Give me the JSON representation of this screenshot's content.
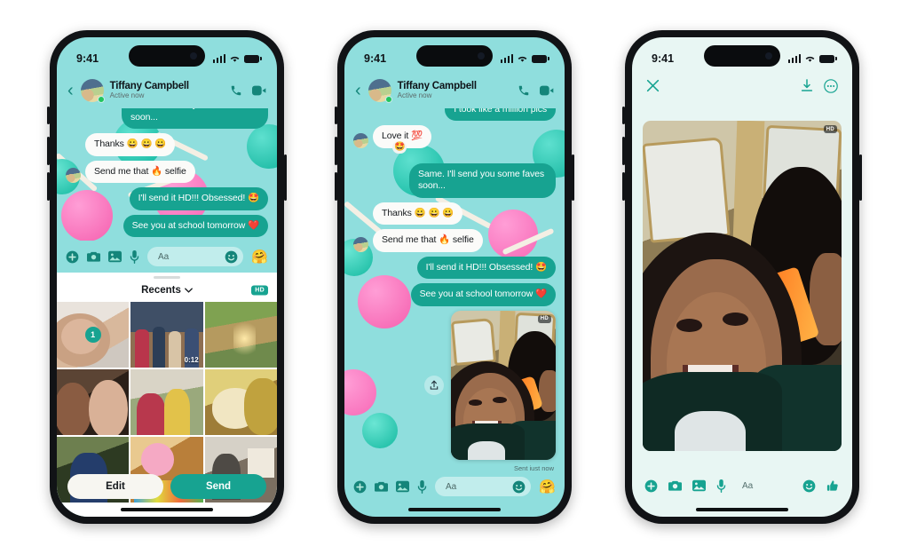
{
  "meta": {
    "accent": "#17a391",
    "chat_bg": "#8fdedd",
    "viewer_bg": "#e8f6f3",
    "bubble_out": "#17a391",
    "bubble_in": "#fbfbf9"
  },
  "status_bar": {
    "time": "9:41",
    "signal_icon": "cellular-signal-icon",
    "wifi_icon": "wifi-icon",
    "battery_icon": "battery-icon"
  },
  "chat_header": {
    "back_icon": "back-chevron-icon",
    "avatar": "contact-avatar",
    "name": "Tiffany Campbell",
    "status": "Active now",
    "call_icon": "phone-call-icon",
    "video_icon": "video-call-icon"
  },
  "phone1": {
    "messages": [
      {
        "id": "m1",
        "dir": "out",
        "text": "Same. I'll send you some faves soon..."
      },
      {
        "id": "m2",
        "dir": "in",
        "text": "Thanks 😀 😀 😀"
      },
      {
        "id": "m3",
        "dir": "in",
        "text": "Send me that 🔥 selfie"
      },
      {
        "id": "m4",
        "dir": "out",
        "text": "I'll send it HD!!! Obsessed! 🤩"
      },
      {
        "id": "m5",
        "dir": "out",
        "text": "See you at school tomorrow ❤️"
      }
    ],
    "input_bar": {
      "plus_icon": "add-attachment-icon",
      "camera_icon": "camera-icon",
      "gallery_icon": "photo-gallery-icon",
      "mic_icon": "microphone-icon",
      "placeholder": "Aa",
      "sticker_icon": "sticker-smiley-icon",
      "like_emoji": "🤗"
    },
    "tray": {
      "title": "Recents",
      "chevron_icon": "chevron-down-icon",
      "hd_badge": "HD",
      "selected_count": "1",
      "video_duration": "0:12",
      "edit_label": "Edit",
      "send_label": "Send"
    }
  },
  "phone2": {
    "messages": [
      {
        "id": "p2m0",
        "dir": "out",
        "text": "I took like a million pics"
      },
      {
        "id": "p2m1",
        "dir": "in",
        "text": "Love it 💯",
        "reaction": "🤩"
      },
      {
        "id": "p2m2",
        "dir": "out",
        "text": "Same. I'll send you some faves soon..."
      },
      {
        "id": "p2m3",
        "dir": "in",
        "text": "Thanks 😀 😀 😀"
      },
      {
        "id": "p2m4",
        "dir": "in",
        "text": "Send me that 🔥 selfie"
      },
      {
        "id": "p2m5",
        "dir": "out",
        "text": "I'll send it HD!!! Obsessed! 🤩"
      },
      {
        "id": "p2m6",
        "dir": "out",
        "text": "See you at school tomorrow ❤️"
      }
    ],
    "photo_message": {
      "share_icon": "share-upload-icon",
      "hd_badge": "HD",
      "sent_label": "Sent just now"
    },
    "input_bar": {
      "plus_icon": "add-attachment-icon",
      "camera_icon": "camera-icon",
      "gallery_icon": "photo-gallery-icon",
      "mic_icon": "microphone-icon",
      "placeholder": "Aa",
      "sticker_icon": "sticker-smiley-icon",
      "like_emoji": "🤗"
    }
  },
  "phone3": {
    "header": {
      "close_icon": "close-x-icon",
      "download_icon": "download-icon",
      "more_icon": "more-options-icon"
    },
    "photo": {
      "hd_badge": "HD"
    },
    "input_bar": {
      "plus_icon": "add-attachment-icon",
      "camera_icon": "camera-icon",
      "gallery_icon": "photo-gallery-icon",
      "mic_icon": "microphone-icon",
      "placeholder": "Aa",
      "sticker_icon": "sticker-smiley-icon",
      "thumbs_icon": "thumbs-up-icon"
    }
  }
}
